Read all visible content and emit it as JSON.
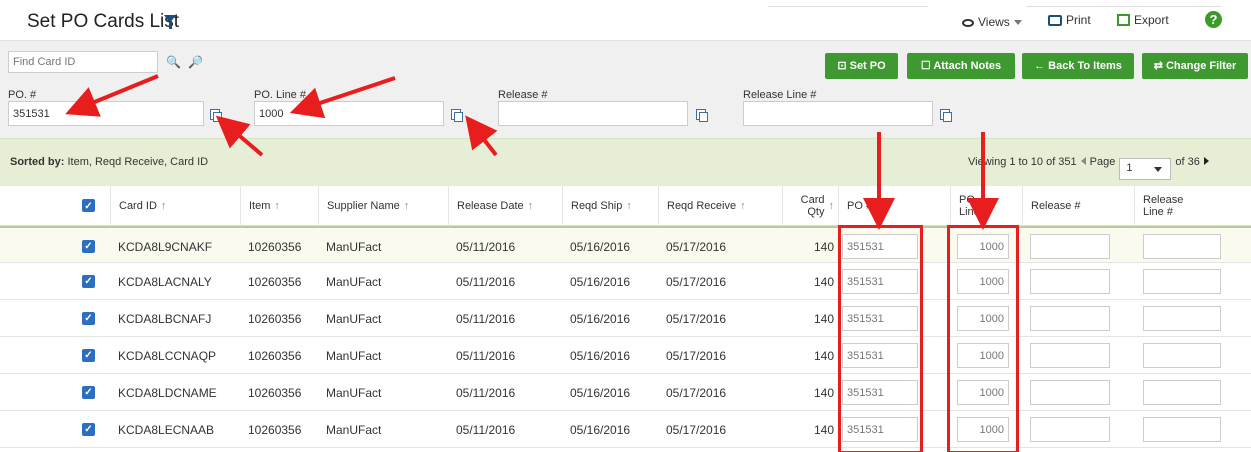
{
  "header": {
    "title": "Set PO Cards List",
    "views_label": "Views",
    "print_label": "Print",
    "export_label": "Export",
    "help_label": "?"
  },
  "filters": {
    "find_card_placeholder": "Find Card ID",
    "po_label": "PO. #",
    "po_value": "351531",
    "po_line_label": "PO. Line #",
    "po_line_value": "1000",
    "release_label": "Release #",
    "release_value": "",
    "release_line_label": "Release Line #",
    "release_line_value": ""
  },
  "actions": {
    "set_po": "⊡ Set PO",
    "attach_notes": "☐ Attach Notes",
    "back_to_items": "← Back To Items",
    "change_filter": "⇄ Change Filter"
  },
  "sortbar": {
    "sorted_by_label": "Sorted by:",
    "sorted_by_value": "Item, Reqd Receive, Card ID",
    "viewing": "Viewing 1 to 10 of 351",
    "page_label": "Page",
    "page_value": "1",
    "of_pages": "of 36"
  },
  "columns": [
    {
      "label": "Card ID",
      "sort": "↑"
    },
    {
      "label": "Item",
      "sort": "↑"
    },
    {
      "label": "Supplier Name",
      "sort": "↑"
    },
    {
      "label": "Release Date",
      "sort": "↑"
    },
    {
      "label": "Reqd Ship",
      "sort": "↑"
    },
    {
      "label": "Reqd Receive",
      "sort": "↑"
    },
    {
      "label": "Card Qty",
      "sort": "↑"
    },
    {
      "label": "PO #",
      "sort": ""
    },
    {
      "label": "PO Line #",
      "sort": ""
    },
    {
      "label": "Release #",
      "sort": ""
    },
    {
      "label": "Release Line #",
      "sort": ""
    }
  ],
  "rows": [
    {
      "card_id": "KCDA8L9CNAKF",
      "item": "10260356",
      "supplier": "ManUFact",
      "release_date": "05/11/2016",
      "reqd_ship": "05/16/2016",
      "reqd_receive": "05/17/2016",
      "qty": "140",
      "po": "351531",
      "po_line": "1000"
    },
    {
      "card_id": "KCDA8LACNALY",
      "item": "10260356",
      "supplier": "ManUFact",
      "release_date": "05/11/2016",
      "reqd_ship": "05/16/2016",
      "reqd_receive": "05/17/2016",
      "qty": "140",
      "po": "351531",
      "po_line": "1000"
    },
    {
      "card_id": "KCDA8LBCNAFJ",
      "item": "10260356",
      "supplier": "ManUFact",
      "release_date": "05/11/2016",
      "reqd_ship": "05/16/2016",
      "reqd_receive": "05/17/2016",
      "qty": "140",
      "po": "351531",
      "po_line": "1000"
    },
    {
      "card_id": "KCDA8LCCNAQP",
      "item": "10260356",
      "supplier": "ManUFact",
      "release_date": "05/11/2016",
      "reqd_ship": "05/16/2016",
      "reqd_receive": "05/17/2016",
      "qty": "140",
      "po": "351531",
      "po_line": "1000"
    },
    {
      "card_id": "KCDA8LDCNAME",
      "item": "10260356",
      "supplier": "ManUFact",
      "release_date": "05/11/2016",
      "reqd_ship": "05/16/2016",
      "reqd_receive": "05/17/2016",
      "qty": "140",
      "po": "351531",
      "po_line": "1000"
    },
    {
      "card_id": "KCDA8LECNAAB",
      "item": "10260356",
      "supplier": "ManUFact",
      "release_date": "05/11/2016",
      "reqd_ship": "05/16/2016",
      "reqd_receive": "05/17/2016",
      "qty": "140",
      "po": "351531",
      "po_line": "1000"
    }
  ],
  "colors": {
    "accent_green": "#3e9a30",
    "annotation_red": "#e81e1e",
    "checkbox_blue": "#2a6fc1"
  }
}
